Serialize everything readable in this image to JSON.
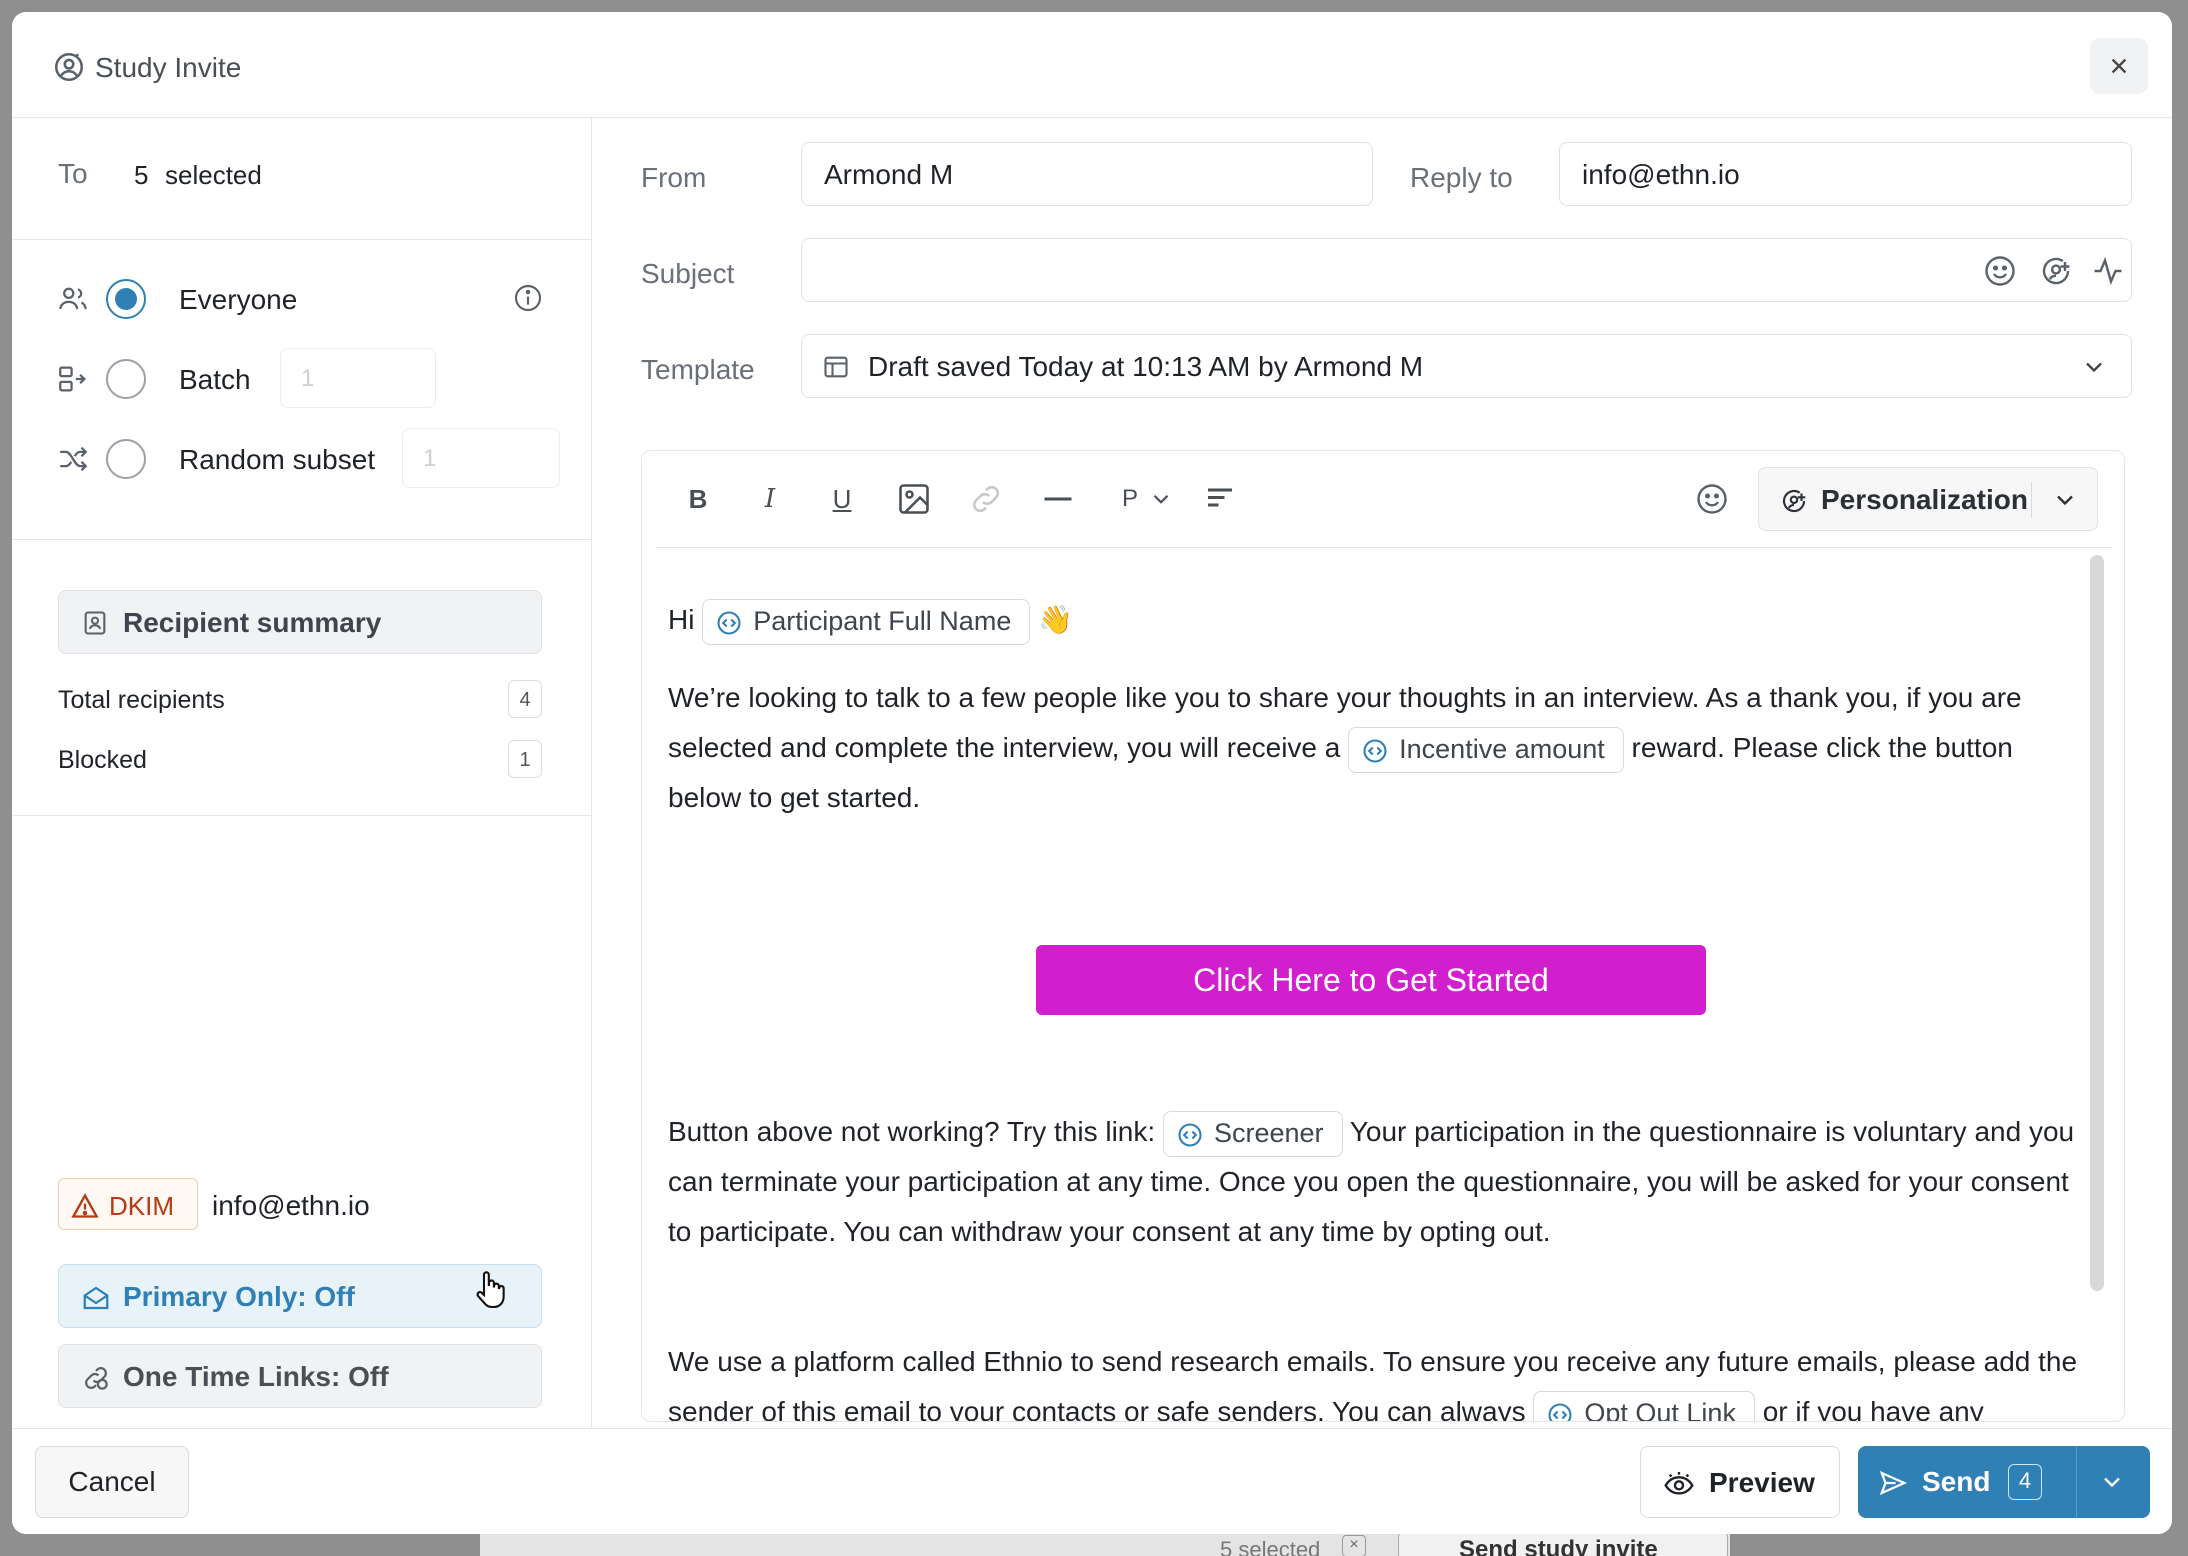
{
  "dialog": {
    "title": "Study Invite",
    "title_icon": "user-circle-icon",
    "close_icon": "close-icon"
  },
  "recipients": {
    "to_label": "To",
    "selected_count": "5",
    "selected_text": "selected",
    "options": [
      {
        "label": "Everyone",
        "icon": "users-icon",
        "selected": true
      },
      {
        "label": "Batch",
        "icon": "batch-icon",
        "selected": false,
        "input_placeholder": "1"
      },
      {
        "label": "Random subset",
        "icon": "shuffle-icon",
        "selected": false,
        "input_placeholder": "1"
      }
    ],
    "summary_button": "Recipient summary",
    "total_label": "Total recipients",
    "total_value": "4",
    "blocked_label": "Blocked",
    "blocked_value": "1"
  },
  "sender": {
    "dkim_label": "DKIM",
    "dkim_email": "info@ethn.io",
    "primary_only": "Primary Only: Off",
    "one_time_links": "One Time Links: Off"
  },
  "form": {
    "from_label": "From",
    "from_value": "Armond M",
    "reply_label": "Reply to",
    "reply_value": "info@ethn.io",
    "subject_label": "Subject",
    "subject_value": "",
    "template_label": "Template",
    "template_value": "Draft saved Today at 10:13 AM by Armond M"
  },
  "toolbar": {
    "bold": "B",
    "italic": "I",
    "underline": "U",
    "paragraph": "P",
    "personalization": "Personalization"
  },
  "body": {
    "greeting": "Hi",
    "chip_name": "Participant Full Name",
    "wave": "👋",
    "p1_a": "We’re looking to talk to a few people like you to share your thoughts in an interview. As a thank you, if you are selected and complete the interview, you will receive a",
    "chip_incentive": "Incentive amount",
    "p1_b": "reward. Please click the button below to get started.",
    "cta": "Click Here to Get Started",
    "p2_a": "Button above not working? Try this link:",
    "chip_screener": "Screener",
    "p2_b": "Your participation in the questionnaire is voluntary and you can terminate your participation at any time. Once you open the questionnaire, you will be asked for your consent to participate. You can withdraw your consent at any time by opting out.",
    "p3_a": "We use a platform called Ethnio to send research emails. To ensure you receive any future emails, please add the sender of this email to your contacts or safe senders. You can always",
    "chip_optout": "Opt Out Link",
    "p3_b": "or if you have any questions, feel free to reply to this email."
  },
  "footer": {
    "cancel": "Cancel",
    "preview": "Preview",
    "send": "Send",
    "send_count": "4"
  },
  "background": {
    "selected": "5 selected",
    "send_invite": "Send study invite"
  },
  "colors": {
    "accent": "#2f80b5",
    "cta": "#d21fcd",
    "warning": "#b83a12"
  }
}
